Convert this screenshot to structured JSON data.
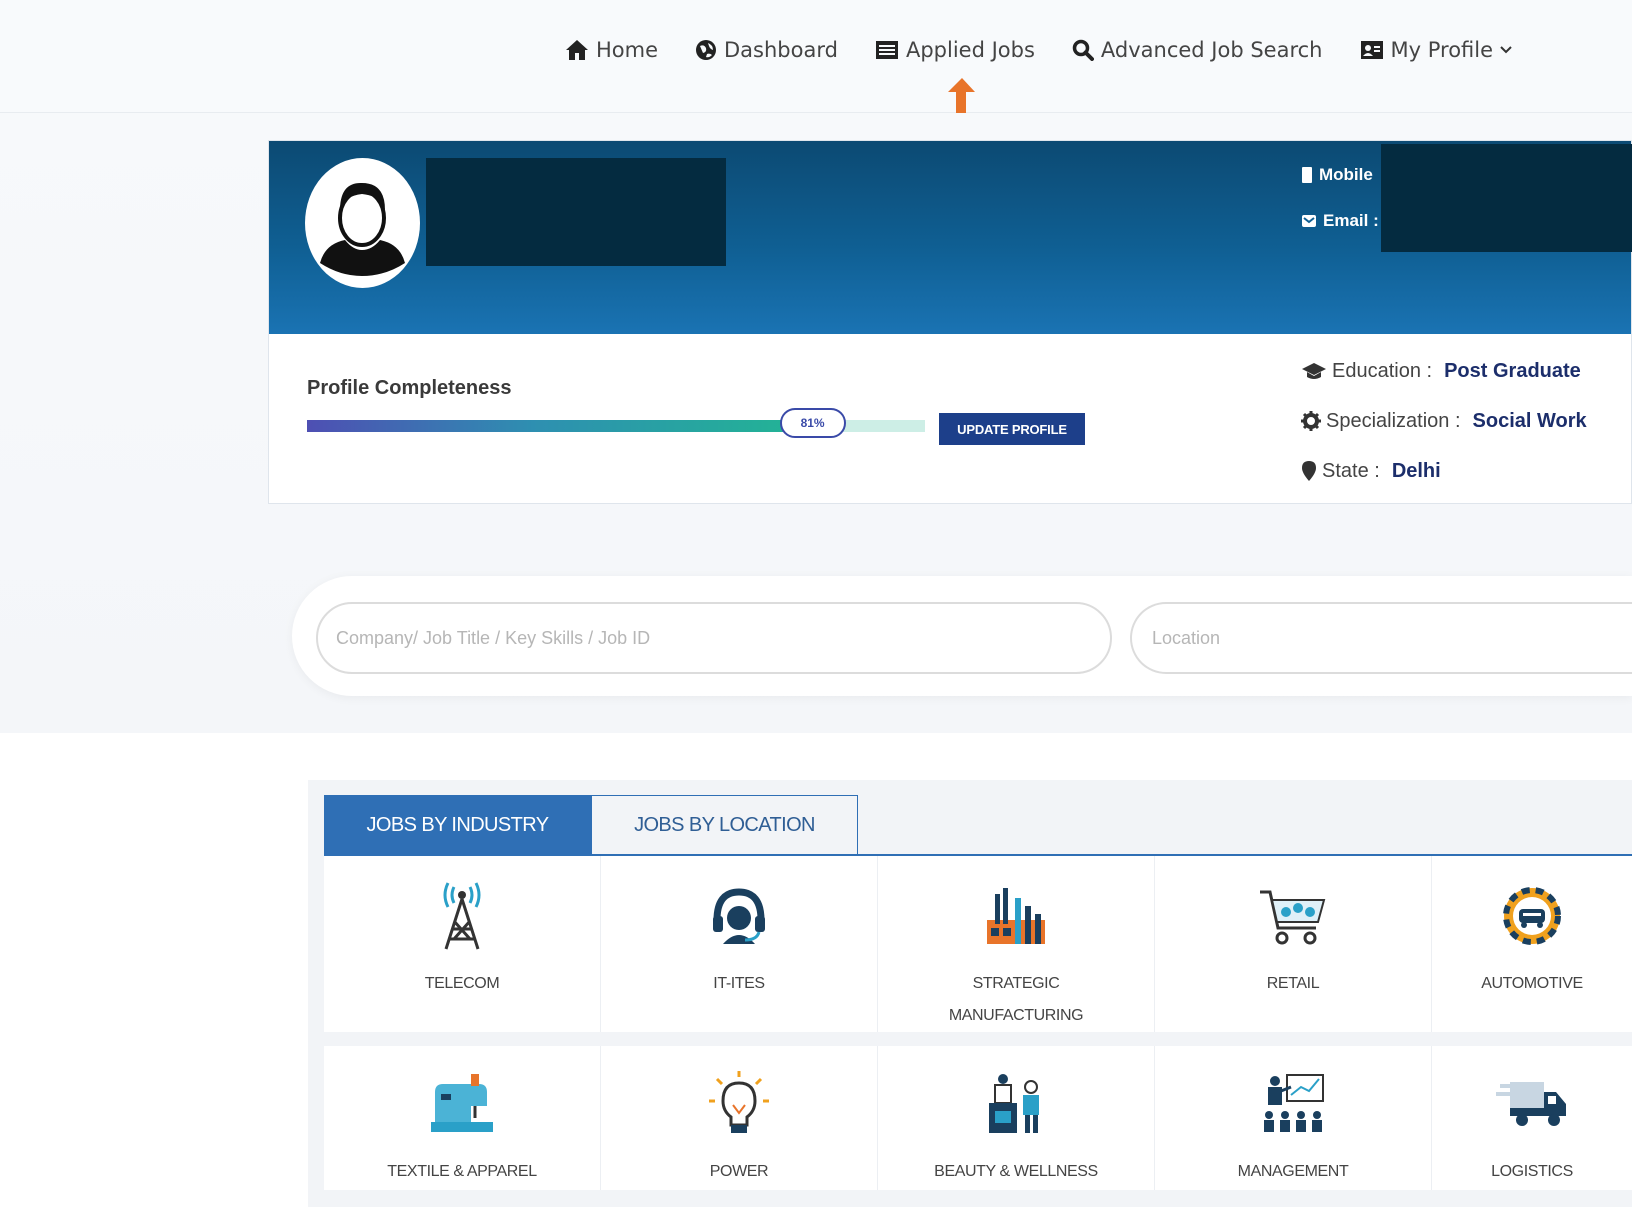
{
  "nav": {
    "items": [
      {
        "label": "Home",
        "icon": "home-icon"
      },
      {
        "label": "Dashboard",
        "icon": "dashboard-icon"
      },
      {
        "label": "Applied Jobs",
        "icon": "list-icon"
      },
      {
        "label": "Advanced Job Search",
        "icon": "search-icon"
      },
      {
        "label": "My Profile",
        "icon": "id-card-icon"
      }
    ]
  },
  "profile": {
    "mobile_label": "Mobile",
    "email_label": "Email :",
    "completeness_title": "Profile Completeness",
    "completeness_percent": 81,
    "completeness_text": "81%",
    "update_button": "UPDATE PROFILE",
    "education_label": "Education :",
    "education_value": "Post Graduate",
    "specialization_label": "Specialization :",
    "specialization_value": "Social Work",
    "state_label": "State :",
    "state_value": "Delhi"
  },
  "search": {
    "keyword_placeholder": "Company/ Job Title / Key Skills / Job ID",
    "location_placeholder": "Location"
  },
  "tabs": {
    "industry": "JOBS BY INDUSTRY",
    "location": "JOBS BY LOCATION"
  },
  "industries": {
    "row1": [
      {
        "label": "TELECOM",
        "icon": "telecom-tower-icon"
      },
      {
        "label": "IT-ITES",
        "icon": "headset-icon"
      },
      {
        "label": "STRATEGIC\nMANUFACTURING",
        "icon": "factory-icon"
      },
      {
        "label": "RETAIL",
        "icon": "shopping-cart-icon"
      },
      {
        "label": "AUTOMOTIVE",
        "icon": "car-gear-icon"
      }
    ],
    "row2": [
      {
        "label": "TEXTILE & APPAREL",
        "icon": "sewing-machine-icon"
      },
      {
        "label": "POWER",
        "icon": "light-bulb-icon"
      },
      {
        "label": "BEAUTY & WELLNESS",
        "icon": "salon-icon"
      },
      {
        "label": "MANAGEMENT",
        "icon": "presentation-icon"
      },
      {
        "label": "LOGISTICS",
        "icon": "truck-icon"
      }
    ]
  },
  "colors": {
    "banner": "#0f5f93",
    "accent": "#2f6fb5",
    "button": "#1d3f8a",
    "annotation": "#e8742a"
  }
}
